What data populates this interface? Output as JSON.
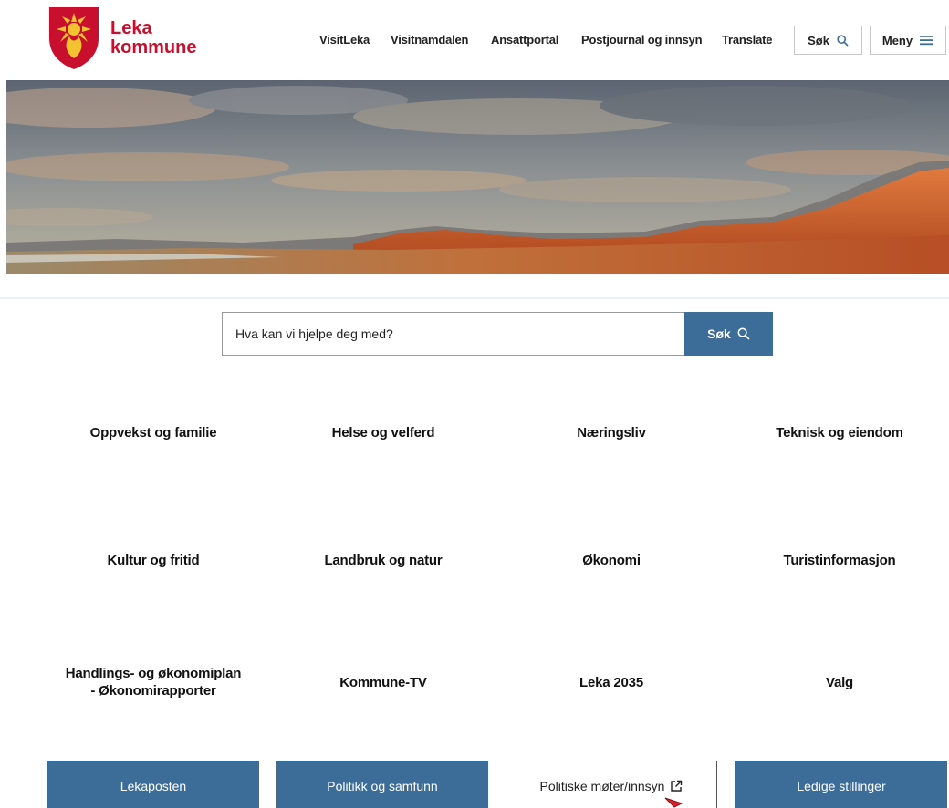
{
  "header": {
    "logo_line1": "Leka",
    "logo_line2": "kommune",
    "nav_links": [
      "VisitLeka",
      "Visitnamdalen",
      "Ansattportal",
      "Postjournal og innsyn",
      "Translate"
    ],
    "search_label": "Søk",
    "menu_label": "Meny"
  },
  "search": {
    "placeholder": "Hva kan vi hjelpe deg med?",
    "button_label": "Søk"
  },
  "tiles": [
    "Oppvekst og familie",
    "Helse og velferd",
    "Næringsliv",
    "Teknisk og eiendom",
    "Kultur og fritid",
    "Landbruk og natur",
    "Økonomi",
    "Turistinformasjon",
    "Handlings- og økonomiplan - Økonomirapporter",
    "Kommune-TV",
    "Leka 2035",
    "Valg"
  ],
  "bottom_buttons": [
    "Lekaposten",
    "Politikk og samfunn",
    "Politiske møter/innsyn",
    "Ledige stillinger"
  ],
  "colors": {
    "brand_red": "#c8102e",
    "brand_yellow": "#f2c230",
    "button_blue": "#3c6d99"
  },
  "icons": {
    "search": "magnifier-icon",
    "menu": "hamburger-icon",
    "external": "external-link-icon"
  }
}
